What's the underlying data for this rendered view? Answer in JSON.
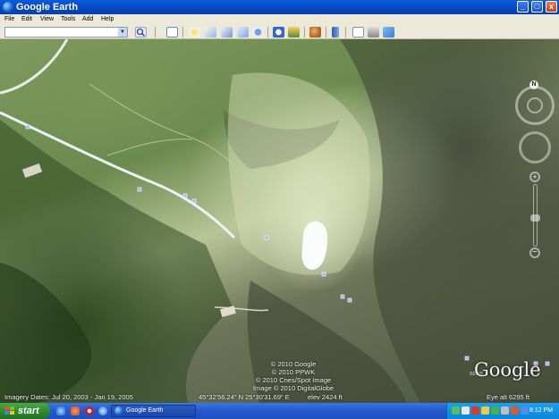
{
  "window": {
    "title": "Google Earth",
    "app_icon": "google-earth-globe-icon"
  },
  "window_controls": {
    "minimize": "_",
    "maximize": "□",
    "close": "x"
  },
  "menu": {
    "items": [
      {
        "label": "File"
      },
      {
        "label": "Edit"
      },
      {
        "label": "View"
      },
      {
        "label": "Tools"
      },
      {
        "label": "Add"
      },
      {
        "label": "Help"
      }
    ]
  },
  "toolbar": {
    "search": {
      "value": "",
      "placeholder": ""
    },
    "buttons": [
      "sidebar-icon",
      "placemark-icon",
      "polygon-icon",
      "path-icon",
      "image-overlay-icon",
      "record-tour-icon",
      "historical-imagery-icon",
      "sunlight-icon",
      "planets-icon",
      "ruler-icon",
      "email-icon",
      "print-icon",
      "google-maps-icon"
    ]
  },
  "map": {
    "north_label": "N",
    "copyright_lines": [
      "© 2010 Google",
      "© 2010 PPWK",
      "© 2010 Cnes/Spot Image",
      "Image © 2010 DigitalGlobe"
    ],
    "logo_text": "Google",
    "logo_year": "©2009",
    "imagery_dates": "Imagery Dates: Jul 20, 2003 - Jan 19, 2005",
    "coordinates": "45°32'56.24\" N    25°30'31.69\" E",
    "elevation": "elev  2424 ft",
    "eye_alt": "Eye alt    6295 ft",
    "zoom_level": 0.45,
    "colors": {
      "road": "#eef2f8",
      "panel": "#ece9d8",
      "titlebar": "#0a5cdb"
    }
  },
  "taskbar": {
    "start_label": "start",
    "quick_launch": [
      "ie-icon",
      "media-icon",
      "opera-icon",
      "globe-icon"
    ],
    "tasks": [
      {
        "label": "Google Earth",
        "icon": "google-earth-globe-icon"
      }
    ],
    "tray_icons": [
      "network-icon",
      "volume-icon",
      "shield-icon",
      "update-icon",
      "messenger-icon",
      "battery-icon",
      "alert-icon",
      "sync-icon"
    ],
    "clock": "8:12 PM"
  }
}
